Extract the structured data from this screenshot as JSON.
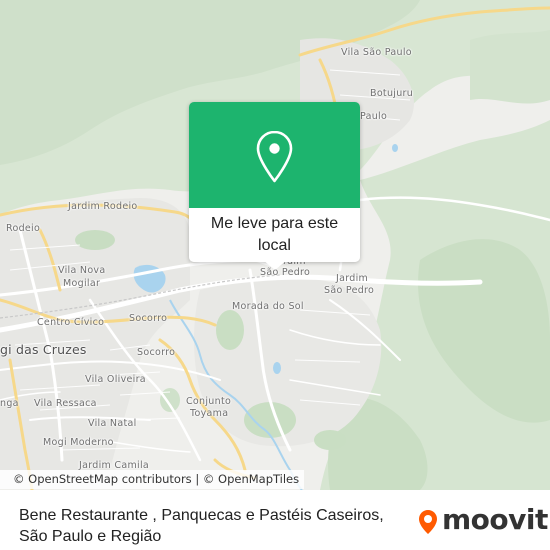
{
  "map": {
    "labels": {
      "vila_sao_paulo": "Vila São Paulo",
      "botujuru": "Botujuru",
      "paulo_partial": "Paulo",
      "jardim_rodeio": "Jardim Rodeio",
      "rodeio": "Rodeio",
      "vila_nova_mogilar_1": "Vila Nova",
      "vila_nova_mogilar_2": "Mogilar",
      "sao_pedro_partial_1": "rdim",
      "sao_pedro_partial_2": "São Pedro",
      "jardim_sao_pedro_1": "Jardim",
      "jardim_sao_pedro_2": "São Pedro",
      "morada_do_sol": "Morada do Sol",
      "centro_civico": "Centro Cívico",
      "socorro_1": "Socorro",
      "socorro_2": "Socorro",
      "mogi_das_cruzes": "gi das Cruzes",
      "vila_oliveira": "Vila Oliveira",
      "vila_ressaca": "Vila Ressaca",
      "nga_partial": "nga",
      "conjunto_toyama_1": "Conjunto",
      "conjunto_toyama_2": "Toyama",
      "vila_natal": "Vila Natal",
      "mogi_moderno": "Mogi Moderno",
      "jardim_camila": "Jardim Camila"
    },
    "attribution": "© OpenStreetMap contributors | © OpenMapTiles"
  },
  "popup": {
    "button_label_line1": "Me leve para este",
    "button_label_line2": "local",
    "pin_icon": "map-pin-icon",
    "accent_color": "#1db46e"
  },
  "footer": {
    "title_line1": "Bene Restaurante , Panquecas e Pastéis Caseiros,",
    "title_line2": "São Paulo e Região",
    "brand": "moovit",
    "brand_color": "#ff5a00"
  }
}
